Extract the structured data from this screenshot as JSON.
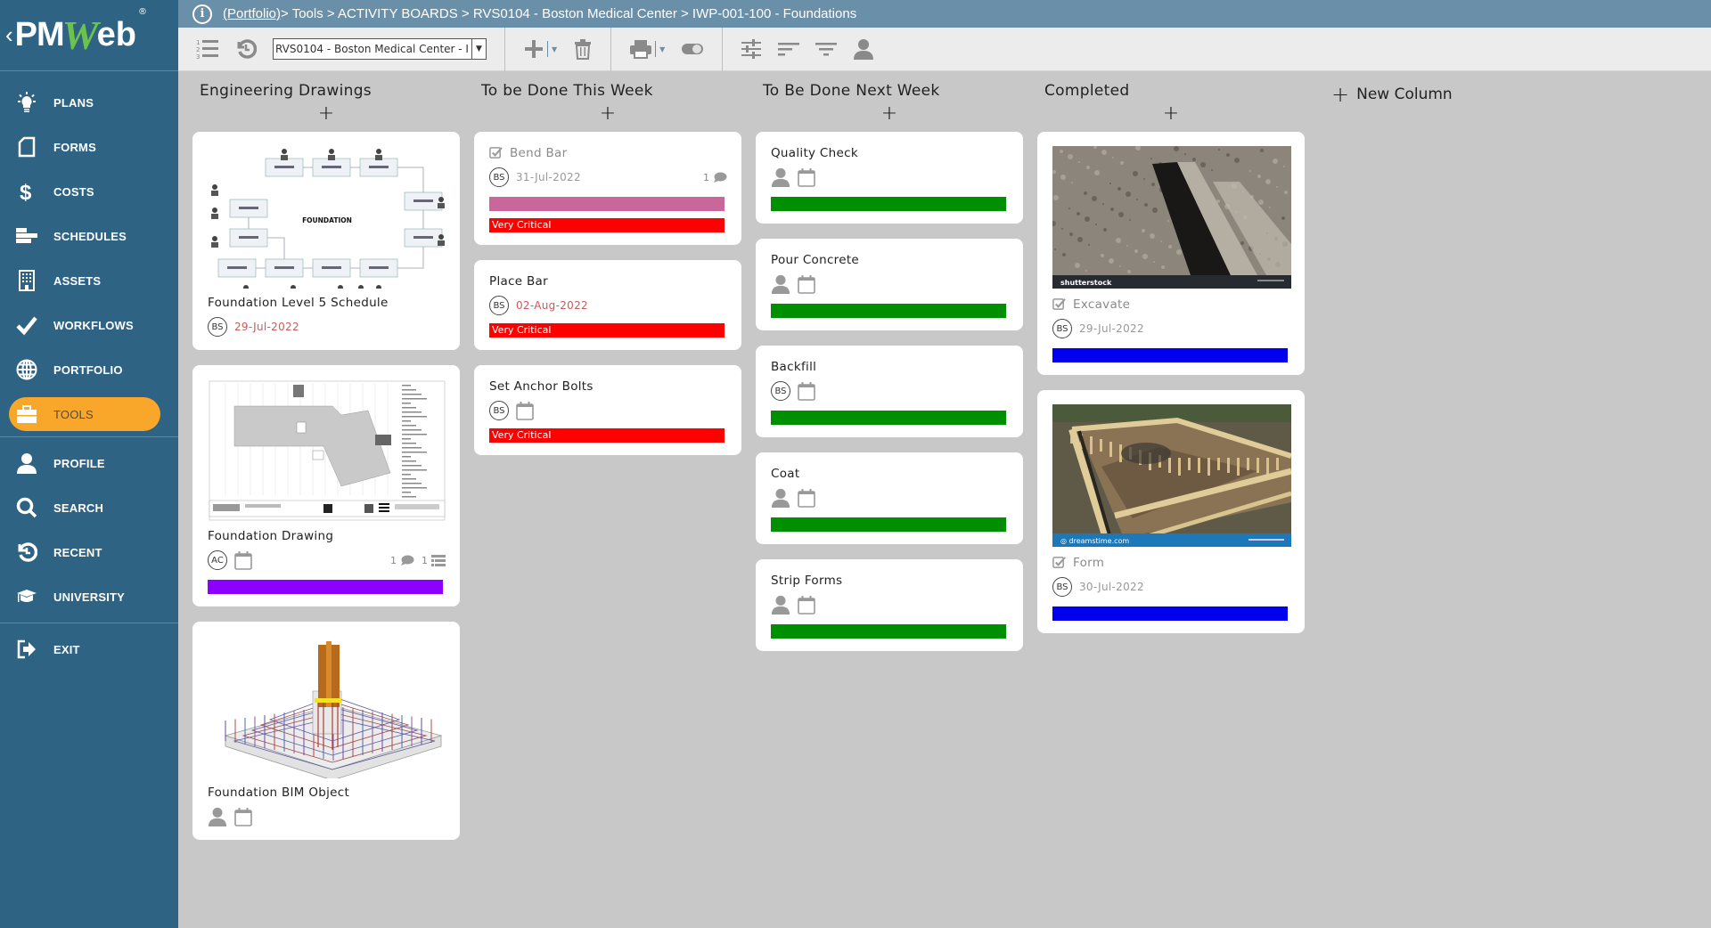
{
  "app": {
    "logo": {
      "prefix": "PM",
      "accent": "W",
      "suffix": "eb",
      "registered": "®",
      "back": "‹"
    }
  },
  "colors": {
    "sidebar": "#2e6384",
    "active_nav": "#f9a72b",
    "breadcrumb_bar": "#6a8fa8",
    "board_bg": "#c8c8c8",
    "very_critical": "#ff0000",
    "green": "#008f00",
    "blue": "#0000ee",
    "purple": "#8b00ff",
    "pink": "#c9679a"
  },
  "sidebar": {
    "items": [
      {
        "label": "PLANS",
        "icon": "lightbulb-icon"
      },
      {
        "label": "FORMS",
        "icon": "document-icon"
      },
      {
        "label": "COSTS",
        "icon": "dollar-icon"
      },
      {
        "label": "SCHEDULES",
        "icon": "gantt-icon"
      },
      {
        "label": "ASSETS",
        "icon": "building-icon"
      },
      {
        "label": "WORKFLOWS",
        "icon": "checkmark-icon"
      },
      {
        "label": "PORTFOLIO",
        "icon": "globe-icon"
      },
      {
        "label": "TOOLS",
        "icon": "briefcase-icon",
        "active": true
      }
    ],
    "items2": [
      {
        "label": "PROFILE",
        "icon": "user-icon"
      },
      {
        "label": "SEARCH",
        "icon": "search-icon"
      },
      {
        "label": "RECENT",
        "icon": "history-icon"
      },
      {
        "label": "UNIVERSITY",
        "icon": "graduation-cap-icon"
      }
    ],
    "exit": {
      "label": "EXIT",
      "icon": "exit-icon"
    }
  },
  "breadcrumb": {
    "root": "(Portfolio)",
    "rest": " > Tools > ACTIVITY BOARDS > RVS0104 - Boston Medical Center > IWP-001-100 - Foundations"
  },
  "toolbar": {
    "project_select": "RVS0104 - Boston Medical Center - I",
    "buttons": [
      "numbered-list",
      "history",
      "add",
      "delete",
      "print",
      "toggle",
      "settings",
      "sort",
      "filter",
      "user"
    ]
  },
  "board": {
    "new_column_label": "New Column",
    "add_symbol": "+",
    "columns": [
      {
        "title": "Engineering Drawings",
        "cards": [
          {
            "title": "Foundation Level 5 Schedule",
            "thumb": "diagram",
            "thumb_title": "FOUNDATION",
            "avatar": "BS",
            "date": "29-Jul-2022",
            "overdue": true
          },
          {
            "title": "Foundation Drawing",
            "thumb": "plan",
            "avatar": "AC",
            "calendar": true,
            "comments": "1",
            "checklist": "1",
            "bar": "#8b00ff"
          },
          {
            "title": "Foundation BIM Object",
            "thumb": "bim",
            "user_placeholder": true,
            "calendar": true
          }
        ]
      },
      {
        "title": "To be Done This Week",
        "cards": [
          {
            "title": "Bend Bar",
            "done": true,
            "avatar": "BS",
            "date": "31-Jul-2022",
            "comments": "1",
            "bar": "#c9679a",
            "label": "Very Critical"
          },
          {
            "title": "Place Bar",
            "avatar": "BS",
            "date": "02-Aug-2022",
            "overdue": true,
            "label": "Very Critical"
          },
          {
            "title": "Set Anchor Bolts",
            "avatar": "BS",
            "calendar": true,
            "label": "Very Critical"
          }
        ]
      },
      {
        "title": "To Be Done Next Week",
        "cards": [
          {
            "title": "Quality Check",
            "user_placeholder": true,
            "calendar": true,
            "bar": "#008f00"
          },
          {
            "title": "Pour Concrete",
            "user_placeholder": true,
            "calendar": true,
            "bar": "#008f00"
          },
          {
            "title": "Backfill",
            "avatar": "BS",
            "calendar": true,
            "bar": "#008f00"
          },
          {
            "title": "Coat",
            "user_placeholder": true,
            "calendar": true,
            "bar": "#008f00"
          },
          {
            "title": "Strip Forms",
            "user_placeholder": true,
            "calendar": true,
            "bar": "#008f00"
          }
        ]
      },
      {
        "title": "Completed",
        "cards": [
          {
            "title": "Excavate",
            "thumb": "trench",
            "thumb_caption": "shutterstock",
            "done": true,
            "avatar": "BS",
            "date": "29-Jul-2022",
            "bar": "#0000ee"
          },
          {
            "title": "Form",
            "thumb": "formwork",
            "thumb_caption": "dreamstime.com",
            "done": true,
            "avatar": "BS",
            "date": "30-Jul-2022",
            "bar": "#0000ee"
          }
        ]
      }
    ]
  }
}
